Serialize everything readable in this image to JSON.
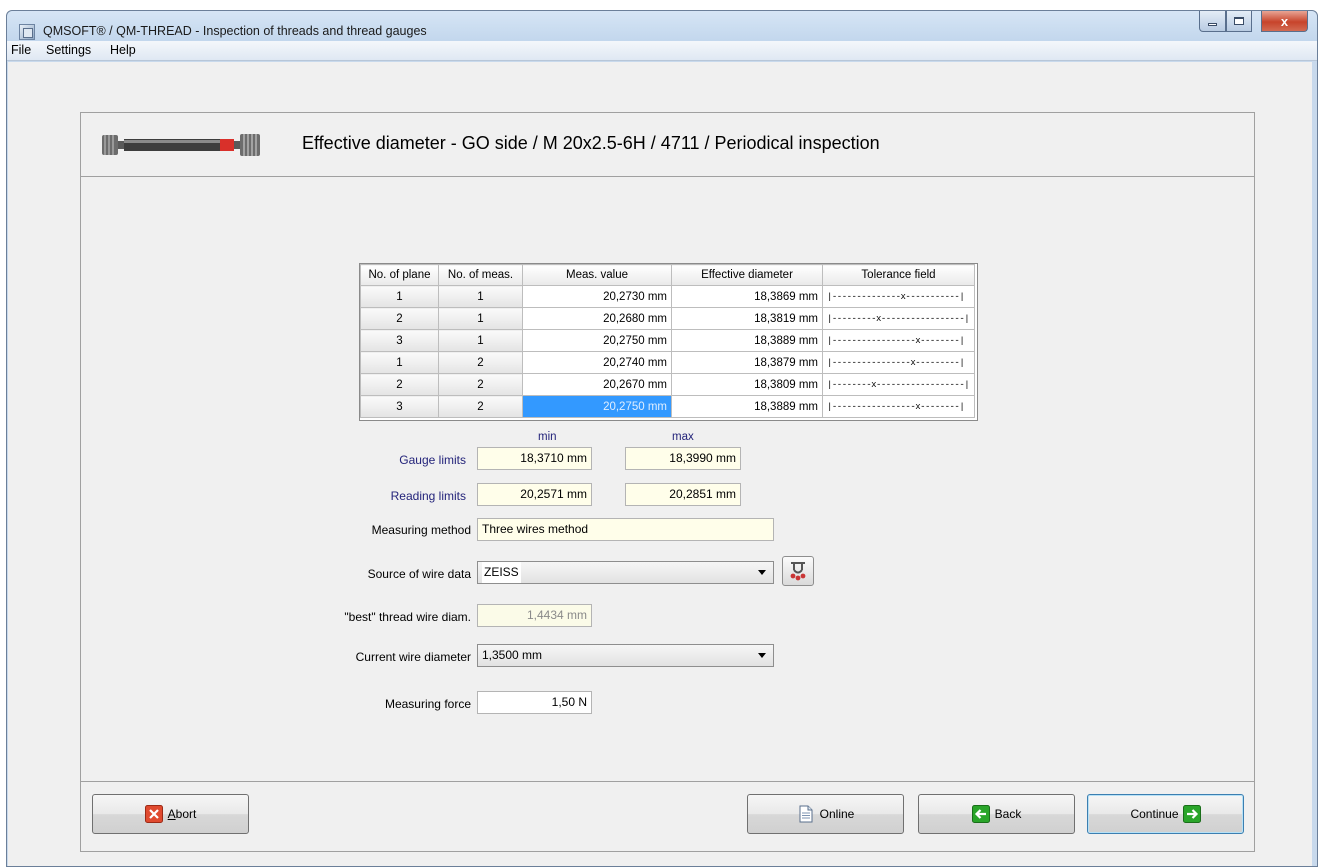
{
  "window": {
    "title": "QMSOFT® / QM-THREAD - Inspection of threads and thread gauges",
    "controls": {
      "close": "x"
    }
  },
  "menu": [
    "File",
    "Settings",
    "Help"
  ],
  "header": {
    "title": "Effective diameter - GO side / M 20x2.5-6H / 4711 / Periodical inspection"
  },
  "grid": {
    "columns": [
      "No. of plane",
      "No. of meas.",
      "Meas. value",
      "Effective diameter",
      "Tolerance field"
    ],
    "rows": [
      {
        "plane": "1",
        "meas": "1",
        "value": "20,2730 mm",
        "eff": "18,3869 mm",
        "tol": "|--------------x-----------|"
      },
      {
        "plane": "2",
        "meas": "1",
        "value": "20,2680 mm",
        "eff": "18,3819 mm",
        "tol": "|---------x-----------------|"
      },
      {
        "plane": "3",
        "meas": "1",
        "value": "20,2750 mm",
        "eff": "18,3889 mm",
        "tol": "|-----------------x--------|"
      },
      {
        "plane": "1",
        "meas": "2",
        "value": "20,2740 mm",
        "eff": "18,3879 mm",
        "tol": "|----------------x---------|"
      },
      {
        "plane": "2",
        "meas": "2",
        "value": "20,2670 mm",
        "eff": "18,3809 mm",
        "tol": "|--------x------------------|"
      },
      {
        "plane": "3",
        "meas": "2",
        "value": "20,2750 mm",
        "eff": "18,3889 mm",
        "tol": "|-----------------x--------|"
      }
    ],
    "selected_row": 5
  },
  "limits": {
    "min_label": "min",
    "max_label": "max",
    "gauge_label": "Gauge limits",
    "gauge_min": "18,3710 mm",
    "gauge_max": "18,3990 mm",
    "reading_label": "Reading limits",
    "reading_min": "20,2571 mm",
    "reading_max": "20,2851 mm"
  },
  "form": {
    "method_label": "Measuring method",
    "method_value": "Three wires method",
    "source_label": "Source of wire data",
    "source_value": "ZEISS",
    "best_wire_label": "\"best\" thread wire diam.",
    "best_wire_value": "1,4434 mm",
    "current_wire_label": "Current wire diameter",
    "current_wire_value": "1,3500 mm",
    "force_label": "Measuring force",
    "force_value": "1,50 N"
  },
  "buttons": {
    "abort_underline": "A",
    "abort_rest": "bort",
    "online": "Online",
    "back": "Back",
    "continue": "Continue"
  },
  "colors": {
    "selection": "#3399ff",
    "readonly_field": "#fffeea",
    "label_blue": "#23237a",
    "abort_red": "#e04a2f",
    "nav_green": "#2aa52a"
  },
  "icons": {
    "abort": "red-x-icon",
    "online": "document-icon",
    "back": "green-arrow-left-icon",
    "continue": "green-arrow-right-icon",
    "wire": "thread-wire-icon",
    "header": "thread-gauge-icon"
  }
}
